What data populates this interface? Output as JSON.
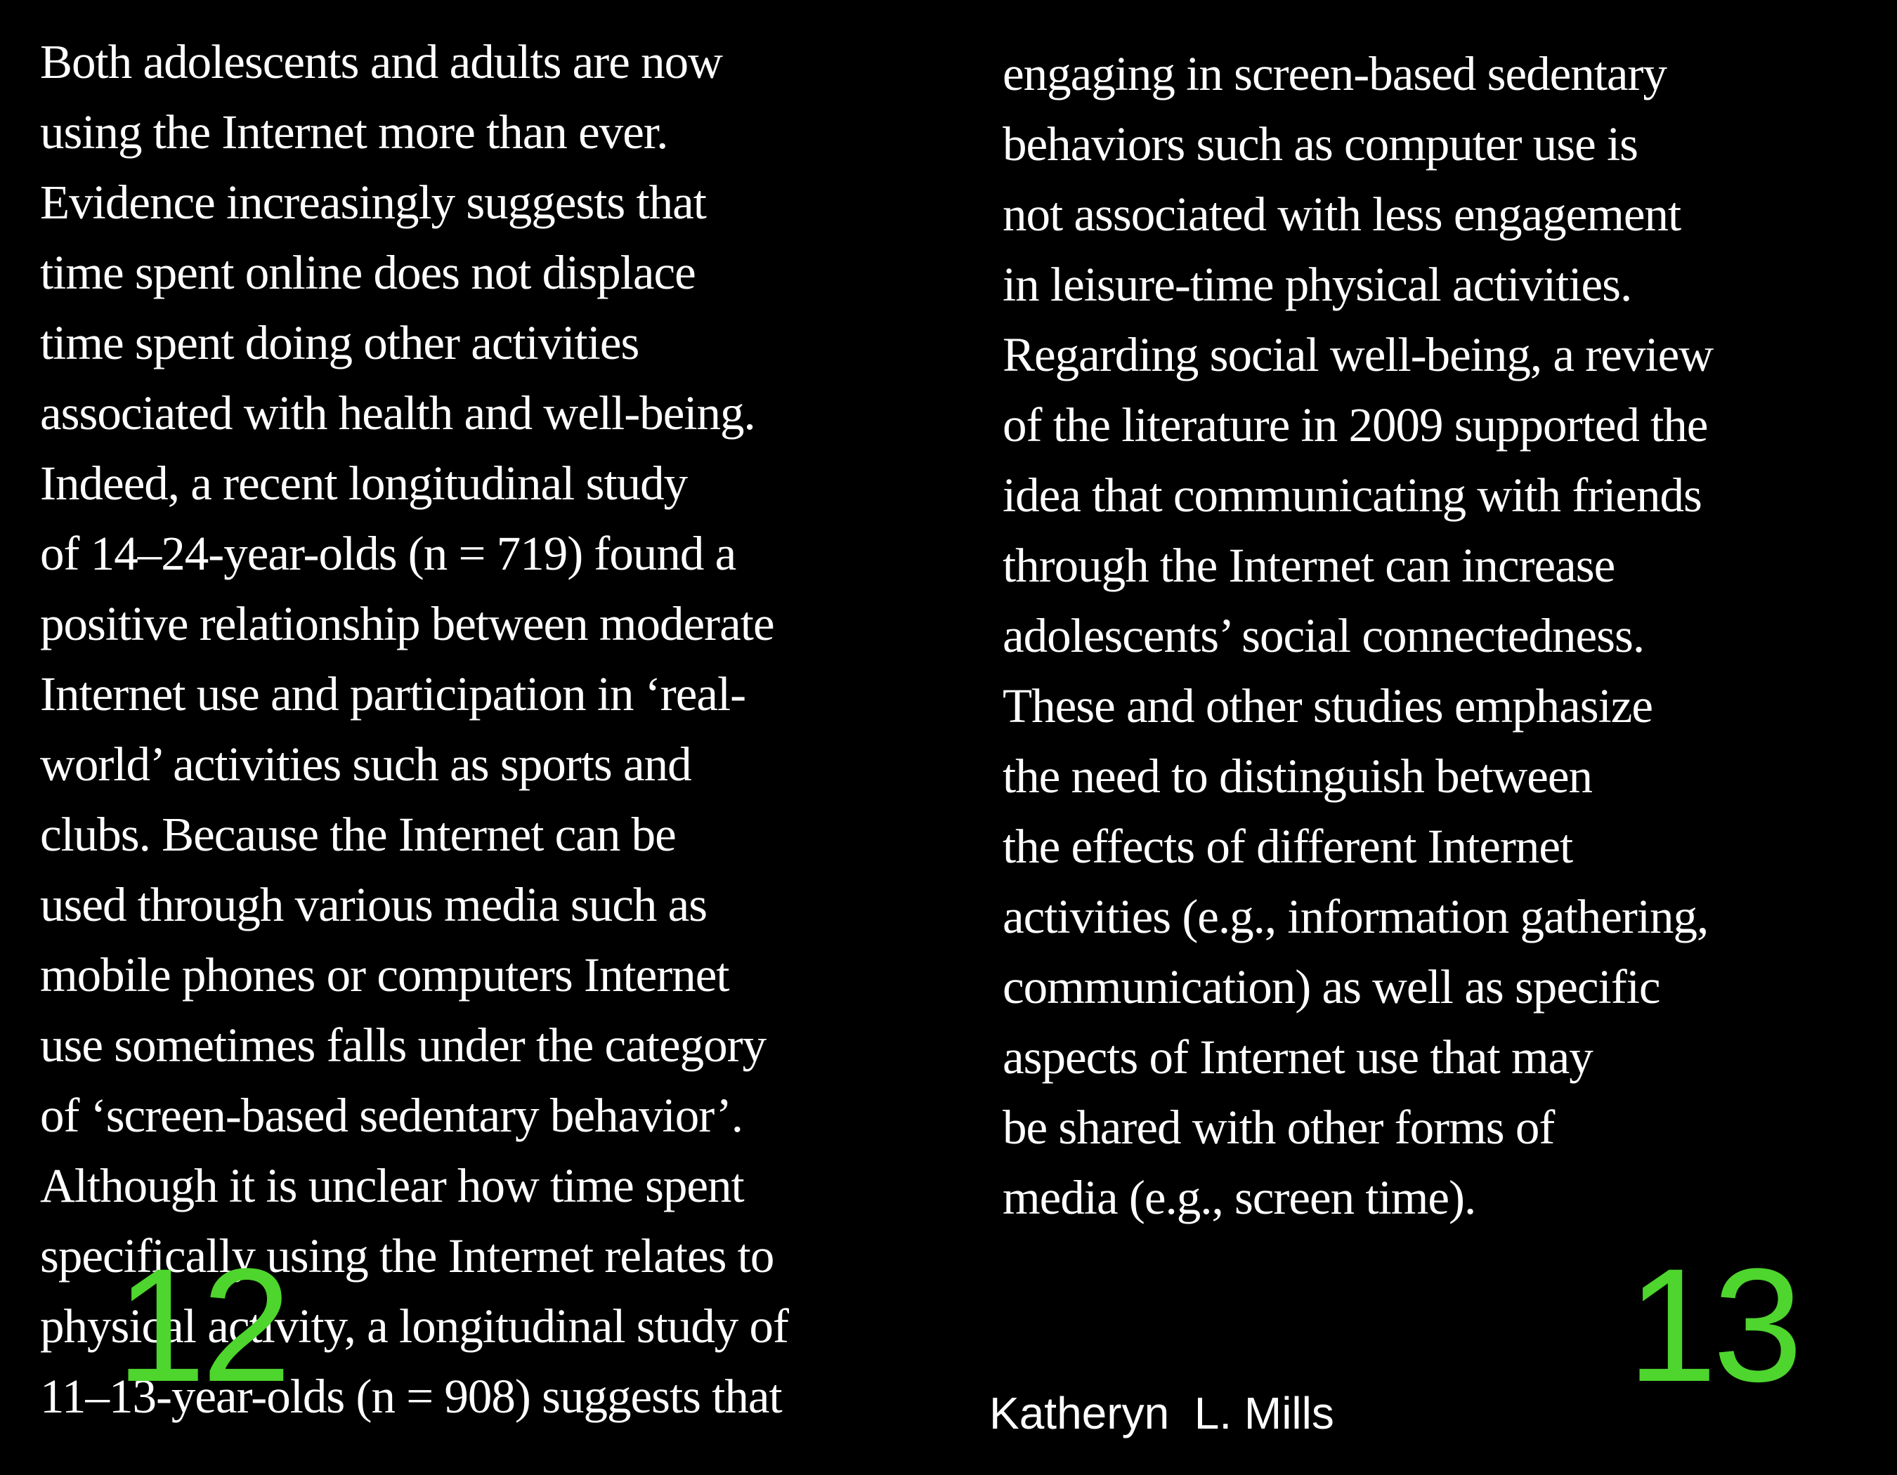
{
  "left_page": {
    "lines": [
      "Both adolescents and adults are now",
      "using the Internet more than ever.",
      "Evidence increasingly suggests that",
      "time spent online does not displace",
      "time spent doing other activities",
      "associated with health and well-being.",
      "Indeed, a recent longitudinal study",
      "of 14–24-year-olds (n = 719) found a",
      "positive relationship between moderate",
      "Internet use and participation in ‘real-",
      "world’ activities such as sports and",
      "clubs. Because the Internet can be",
      "used through various media such as",
      "mobile phones or computers Internet",
      "use sometimes falls under the category",
      "of ‘screen-based sedentary behavior’.",
      "Although it is unclear how time spent",
      "specifically using the Internet relates to",
      "physical activity, a longitudinal study of",
      "11–13-year-olds (n = 908) suggests that"
    ],
    "page_number": "12"
  },
  "right_page": {
    "lines": [
      "engaging in screen-based sedentary",
      "behaviors such as computer use is",
      "not associated with less engagement",
      "in leisure-time physical activities.",
      "Regarding social well-being, a review",
      "of the literature in 2009 supported the",
      "idea that communicating with friends",
      "through the Internet can increase",
      "adolescents’ social connectedness.",
      "These and other studies emphasize",
      "the need to distinguish between",
      "the effects of different Internet",
      "activities (e.g., information gathering,",
      "communication) as well as specific",
      "aspects of Internet use that may",
      "be shared with other forms of",
      "media (e.g., screen time)."
    ],
    "page_number": "13",
    "author": "Katheryn  L. Mills"
  },
  "colors": {
    "background": "#000000",
    "body_text": "#ffffff",
    "page_number": "#4ed52e",
    "author": "#ffffff"
  }
}
